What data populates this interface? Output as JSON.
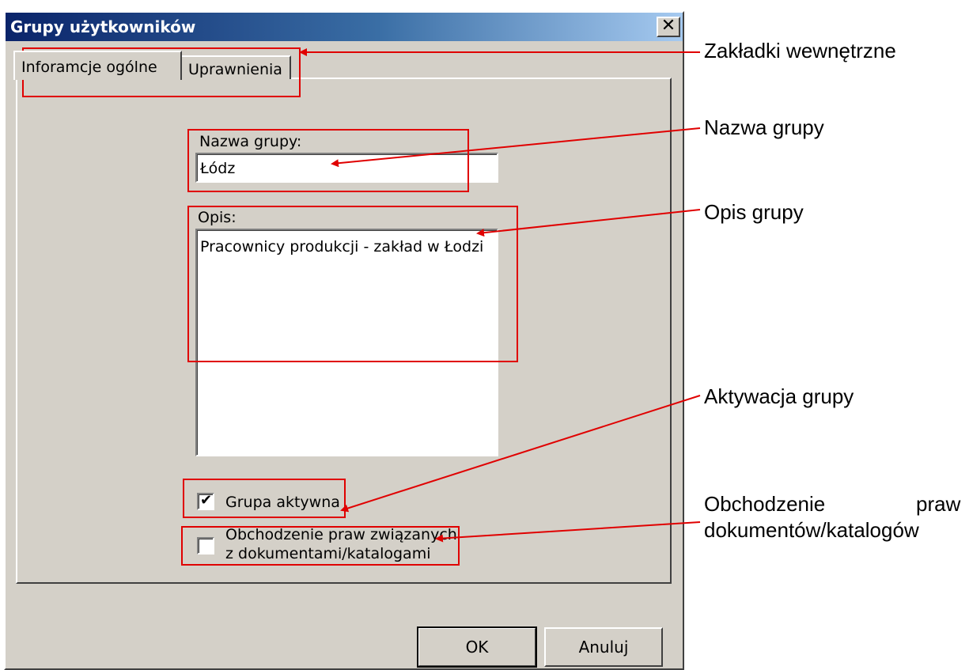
{
  "window": {
    "title": "Grupy użytkowników",
    "close_glyph": "✕"
  },
  "tabs": [
    {
      "label": "Inforamcje ogólne",
      "active": true
    },
    {
      "label": "Uprawnienia",
      "active": false
    }
  ],
  "form": {
    "group_name_label": "Nazwa grupy:",
    "group_name_value": "Łódz",
    "description_label": "Opis:",
    "description_value": "Pracownicy produkcji - zakład w Łodzi",
    "active_checkbox": {
      "label": "Grupa aktywna",
      "checked": true
    },
    "bypass_checkbox": {
      "label_line1": "Obchodzenie praw związanych",
      "label_line2": "z dokumentami/katalogami",
      "checked": false
    }
  },
  "buttons": {
    "ok_label": "OK",
    "cancel_label": "Anuluj"
  },
  "annotations": {
    "tabs": "Zakładki wewnętrzne",
    "group_name": "Nazwa grupy",
    "description": "Opis grupy",
    "activation": "Aktywacja grupy",
    "bypass_line1_left": "Obchodzenie",
    "bypass_line1_right": "praw",
    "bypass_line2": "dokumentów/katalogów"
  },
  "colors": {
    "dialog_background": "#d4d0c8",
    "titlebar_start": "#0a246a",
    "titlebar_end": "#a6caf0",
    "callout_red": "#e00000"
  }
}
